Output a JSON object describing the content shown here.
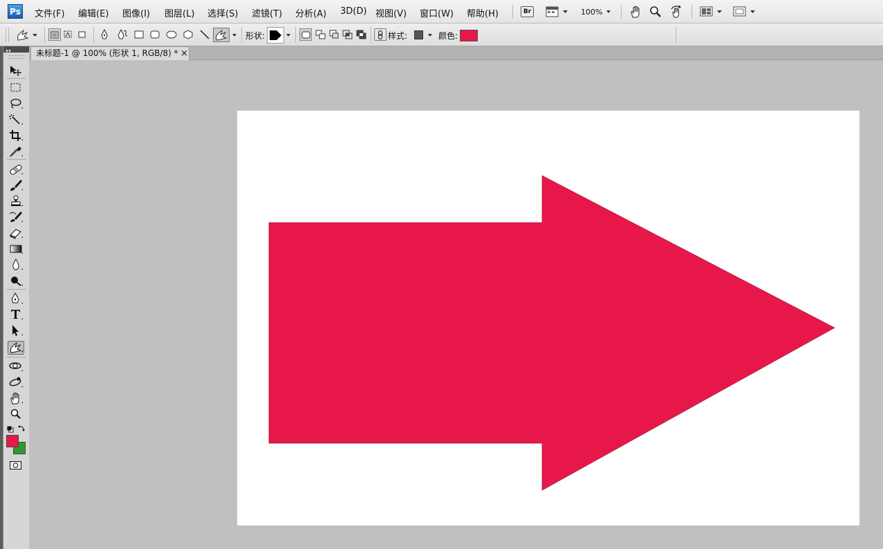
{
  "app": {
    "logo_text": "Ps"
  },
  "menubar": {
    "items": [
      "文件(F)",
      "编辑(E)",
      "图像(I)",
      "图层(L)",
      "选择(S)",
      "滤镜(T)",
      "分析(A)",
      "3D(D)",
      "视图(V)",
      "窗口(W)",
      "帮助(H)"
    ],
    "bridge_label": "Br",
    "zoom": "100%"
  },
  "options": {
    "shape_label": "形状:",
    "style_label": "样式:",
    "color_label": "颜色:",
    "shape_color": "#e8174a",
    "style_swatch": "#555555"
  },
  "document": {
    "tab_title": "未标题-1 @ 100% (形状 1, RGB/8) *",
    "close_glyph": "×",
    "shape": {
      "type": "right-arrow",
      "fill": "#e8174a"
    }
  },
  "toolbox": {
    "foreground_color": "#e8174a",
    "background_color": "#2f9a2f"
  }
}
